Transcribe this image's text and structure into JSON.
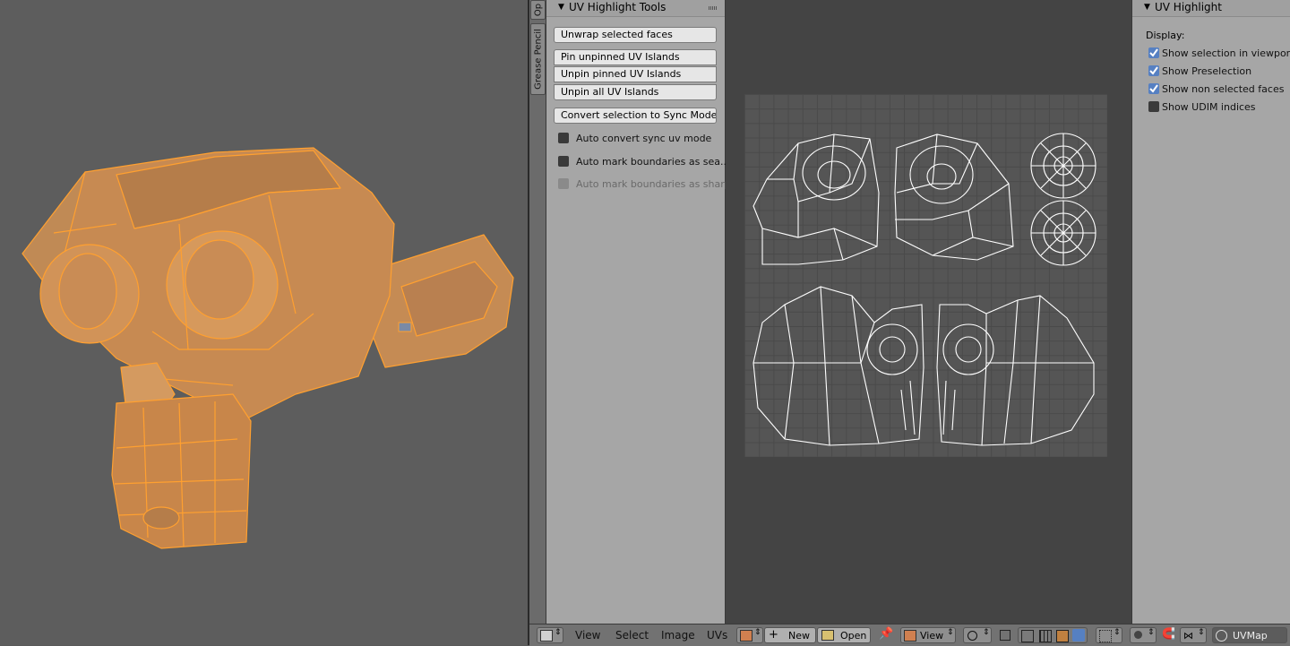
{
  "tool_shelf": {
    "tabs": [
      "Op",
      "Grease Pencil"
    ],
    "panel_title": "UV Highlight Tools",
    "buttons": {
      "unwrap": "Unwrap selected faces",
      "pin": "Pin unpinned UV Islands",
      "unpin": "Unpin pinned UV Islands",
      "unpin_all": "Unpin all UV Islands",
      "convert": "Convert selection to Sync Mode"
    },
    "options": {
      "auto_convert": "Auto convert sync uv mode",
      "auto_mark_seams": "Auto mark boundaries as sea...",
      "auto_mark_sharp": "Auto mark boundaries as sharp"
    }
  },
  "properties": {
    "panel_title": "UV Highlight",
    "display_label": "Display:",
    "options": [
      {
        "label": "Show selection in viewport",
        "checked": true
      },
      {
        "label": "Show Preselection",
        "checked": true
      },
      {
        "label": "Show non selected faces",
        "checked": true
      },
      {
        "label": "Show UDIM indices",
        "checked": false
      }
    ]
  },
  "header": {
    "menus": {
      "view": "View",
      "select": "Select",
      "image": "Image",
      "uvs": "UVs"
    },
    "new_label": "New",
    "open_label": "Open",
    "view_label": "View",
    "uvmap_label": "UVMap"
  },
  "colors": {
    "mesh_orange": "#c8864a",
    "edge_orange": "#ffa030",
    "checkbox_blue": "#5680c2"
  }
}
